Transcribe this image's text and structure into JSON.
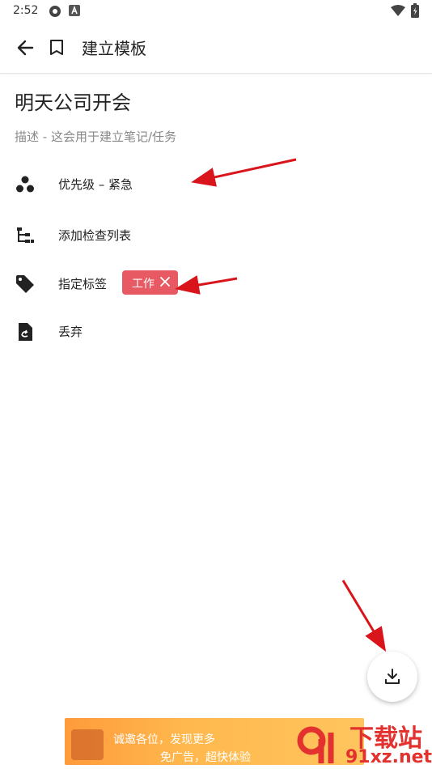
{
  "status_bar": {
    "time": "2:52"
  },
  "app_bar": {
    "title": "建立模板"
  },
  "template": {
    "title": "明天公司开会",
    "description_placeholder": "描述 - 这会用于建立笔记/任务"
  },
  "options": [
    {
      "label": "优先级 – 紧急",
      "icon": "priority-dots-icon"
    },
    {
      "label": "添加检查列表",
      "icon": "checklist-tree-icon"
    },
    {
      "label": "指定标签",
      "icon": "tag-icon"
    },
    {
      "label": "丢弃",
      "icon": "discard-file-icon"
    }
  ],
  "tag_chip": {
    "label": "工作",
    "icon": "close-icon"
  },
  "fab": {
    "icon": "save-download-icon"
  },
  "ad": {
    "line1": "诚邀各位，发现更多",
    "line2": "免广告，超快体验"
  },
  "watermark": {
    "line1": "下载站",
    "line2": "91xz.net"
  },
  "colors": {
    "chip": "#e85a63",
    "arrow": "#d9141b",
    "accent": "#e2312e"
  }
}
